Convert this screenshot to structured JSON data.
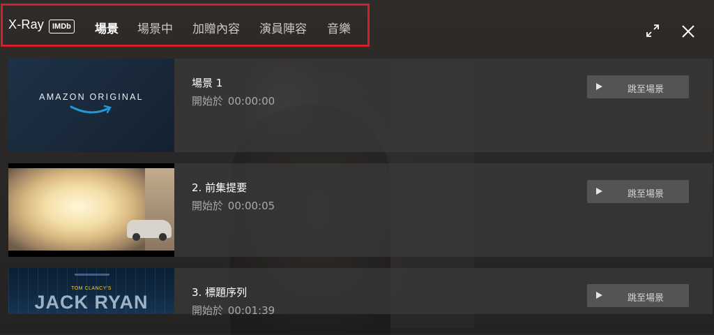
{
  "header": {
    "brand": "X-Ray",
    "imdb_badge": "IMDb",
    "tabs": [
      {
        "label": "場景",
        "active": true
      },
      {
        "label": "場景中",
        "active": false
      },
      {
        "label": "加贈內容",
        "active": false
      },
      {
        "label": "演員陣容",
        "active": false
      },
      {
        "label": "音樂",
        "active": false
      }
    ],
    "expand_icon": "expand-icon",
    "close_icon": "close-icon",
    "highlight_color": "#d2202a"
  },
  "scenes": [
    {
      "title": "場景 1",
      "start_label": "開始於",
      "start_time": "00:00:00",
      "jump_label": "跳至場景",
      "thumbnail_text": "AMAZON ORIGINAL"
    },
    {
      "title": "2. 前集提要",
      "start_label": "開始於",
      "start_time": "00:00:05",
      "jump_label": "跳至場景"
    },
    {
      "title": "3. 標題序列",
      "start_label": "開始於",
      "start_time": "00:01:39",
      "jump_label": "跳至場景",
      "thumbnail_text": "JACK RYAN",
      "thumbnail_kicker": "TOM CLANCY'S"
    }
  ]
}
